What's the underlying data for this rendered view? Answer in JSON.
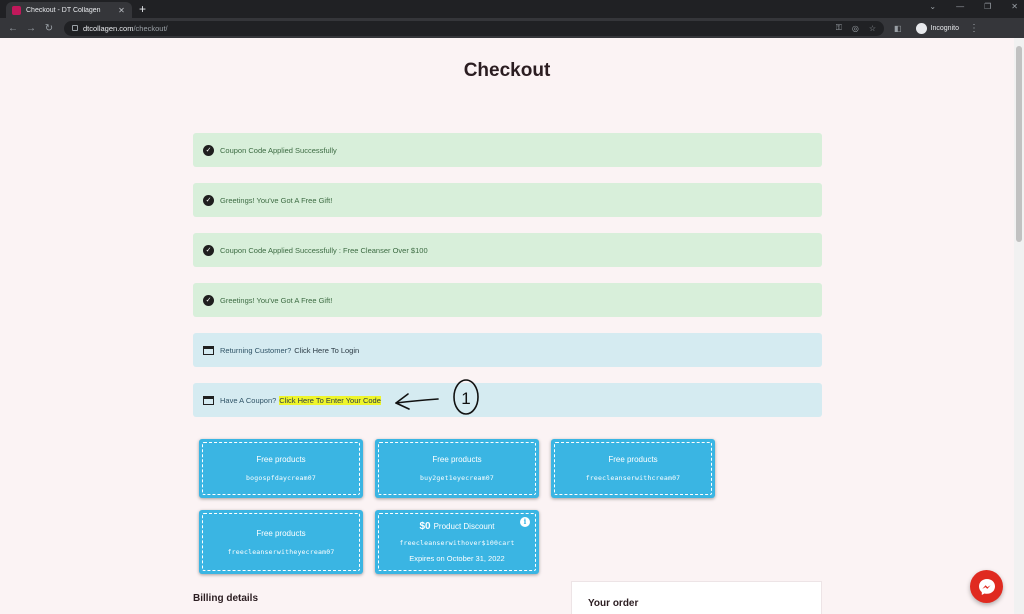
{
  "browser": {
    "tab_title": "Checkout - DT Collagen",
    "tab_close": "✕",
    "new_tab": "+",
    "url_host": "dtcollagen.com",
    "url_path": "/checkout/",
    "profile_label": "Incognito",
    "window_controls": {
      "chevron": "⌄",
      "minimize": "—",
      "restore": "❐",
      "close": "✕"
    },
    "nav": {
      "back": "←",
      "forward": "→",
      "reload": "↻"
    },
    "toolbar_icons": {
      "key": "⚿",
      "eye_off": "◎",
      "star": "☆",
      "sidebar": "◧",
      "menu": "⋮"
    }
  },
  "page": {
    "title": "Checkout",
    "notices": [
      {
        "type": "success",
        "text": "Coupon Code Applied Successfully"
      },
      {
        "type": "success",
        "text": "Greetings! You've Got A Free Gift!"
      },
      {
        "type": "success",
        "text": "Coupon Code Applied Successfully : Free Cleanser Over $100"
      },
      {
        "type": "success",
        "text": "Greetings! You've Got A Free Gift!"
      },
      {
        "type": "info",
        "text": "Returning Customer?",
        "link": "Click Here To Login"
      },
      {
        "type": "info",
        "text": "Have A Coupon?",
        "link": "Click Here To Enter Your Code"
      }
    ],
    "annotation_number": "1",
    "coupons": [
      {
        "title": "Free products",
        "code": "bogospfdaycream07"
      },
      {
        "title": "Free products",
        "code": "buy2get1eyecream07"
      },
      {
        "title": "Free products",
        "code": "freecleanserwithcream07"
      },
      {
        "title": "Free products",
        "code": "freecleanserwitheyecream07"
      },
      {
        "amount": "$0",
        "title": "Product Discount",
        "code": "freecleanserwithover$100cart",
        "expiry": "Expires on October 31, 2022",
        "info": "i"
      }
    ],
    "billing_heading": "Billing details",
    "order_heading": "Your order"
  },
  "colors": {
    "page_bg": "#fbf3f4",
    "success_bg": "#d8efda",
    "info_bg": "#d5ebf1",
    "coupon_bg": "#3ab5e3",
    "highlight": "#eef52a",
    "messenger": "#e02a20"
  },
  "icons": [
    "check-circle-icon",
    "window-icon",
    "info-icon",
    "messenger-icon",
    "lock-icon",
    "arrow-left-icon",
    "arrow-right-icon",
    "reload-icon"
  ]
}
